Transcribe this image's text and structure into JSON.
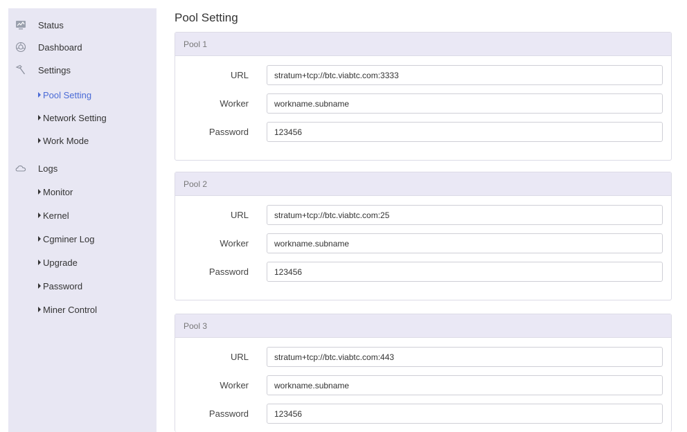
{
  "sidebar": {
    "top": [
      {
        "label": "Status",
        "icon": "monitor-icon"
      },
      {
        "label": "Dashboard",
        "icon": "dashboard-icon"
      },
      {
        "label": "Settings",
        "icon": "hammer-icon"
      },
      {
        "label": "Logs",
        "icon": "cloud-icon"
      }
    ],
    "settings_sub": [
      {
        "label": "Pool Setting",
        "active": true
      },
      {
        "label": "Network Setting"
      },
      {
        "label": "Work Mode"
      }
    ],
    "logs_sub": [
      {
        "label": "Monitor"
      },
      {
        "label": "Kernel"
      },
      {
        "label": "Cgminer Log"
      },
      {
        "label": "Upgrade"
      },
      {
        "label": "Password"
      },
      {
        "label": "Miner Control"
      }
    ]
  },
  "main": {
    "title": "Pool Setting",
    "labels": {
      "url": "URL",
      "worker": "Worker",
      "password": "Password"
    },
    "pools": [
      {
        "name": "Pool 1",
        "url": "stratum+tcp://btc.viabtc.com:3333",
        "worker": "workname.subname",
        "password": "123456"
      },
      {
        "name": "Pool 2",
        "url": "stratum+tcp://btc.viabtc.com:25",
        "worker": "workname.subname",
        "password": "123456"
      },
      {
        "name": "Pool 3",
        "url": "stratum+tcp://btc.viabtc.com:443",
        "worker": "workname.subname",
        "password": "123456"
      }
    ]
  },
  "colors": {
    "sidebar_bg": "#e8e7f3",
    "pool_header_bg": "#eae8f5",
    "active_link": "#4a6bd6"
  }
}
